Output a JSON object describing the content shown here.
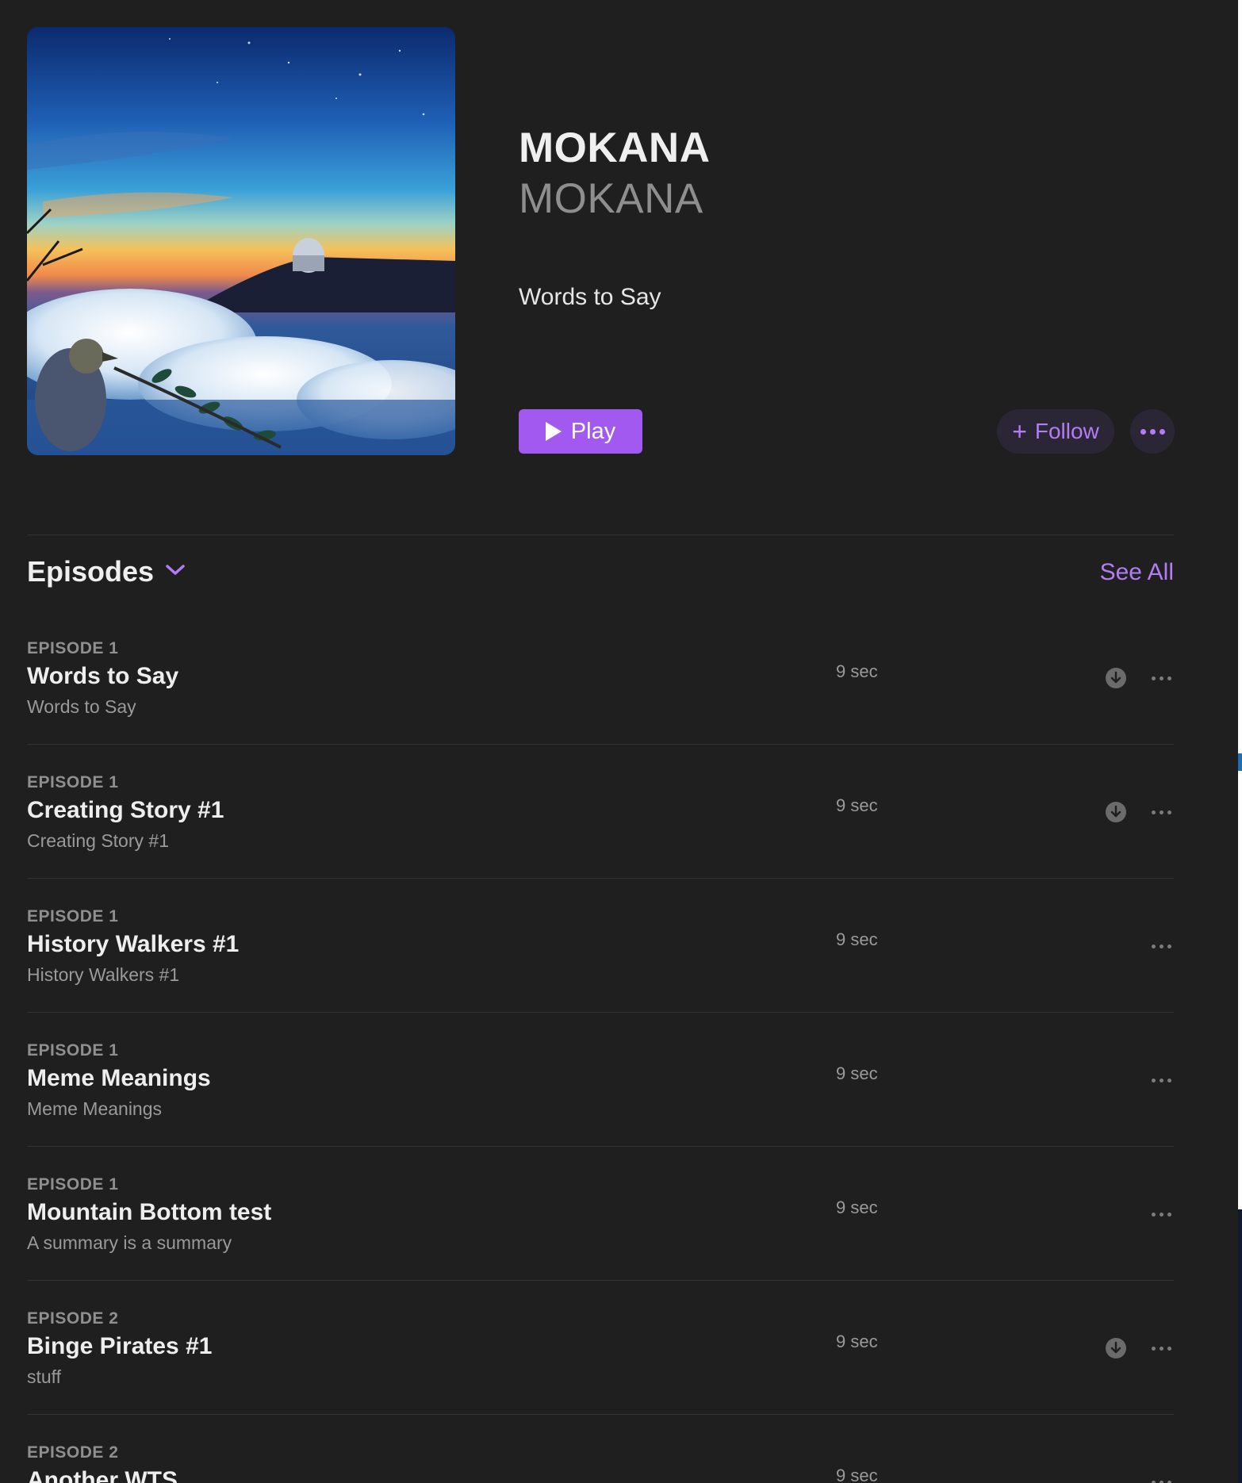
{
  "show": {
    "title": "MOKANA",
    "author": "MOKANA",
    "tagline": "Words to Say",
    "artwork_icon": "podcast-artwork-observatory"
  },
  "actions": {
    "play_label": "Play",
    "follow_label": "Follow",
    "more_icon": "ellipsis-icon"
  },
  "episodes_section": {
    "heading": "Episodes",
    "see_all": "See All"
  },
  "colors": {
    "accent": "#a259f0",
    "accent_text": "#b37cf5",
    "background": "#1f1f1f"
  },
  "episodes": [
    {
      "number": "EPISODE 1",
      "title": "Words to Say",
      "summary": "Words to Say",
      "duration": "9 sec",
      "downloaded": true
    },
    {
      "number": "EPISODE 1",
      "title": "Creating Story #1",
      "summary": "Creating Story #1",
      "duration": "9 sec",
      "downloaded": true
    },
    {
      "number": "EPISODE 1",
      "title": "History Walkers #1",
      "summary": "History Walkers #1",
      "duration": "9 sec",
      "downloaded": false
    },
    {
      "number": "EPISODE 1",
      "title": "Meme Meanings",
      "summary": "Meme Meanings",
      "duration": "9 sec",
      "downloaded": false
    },
    {
      "number": "EPISODE 1",
      "title": "Mountain Bottom test",
      "summary": "A summary is a summary",
      "duration": "9 sec",
      "downloaded": false
    },
    {
      "number": "EPISODE 2",
      "title": "Binge Pirates #1",
      "summary": "stuff",
      "duration": "9 sec",
      "downloaded": true
    },
    {
      "number": "EPISODE 2",
      "title": "Another WTS",
      "summary": "",
      "duration": "9 sec",
      "downloaded": false
    }
  ]
}
